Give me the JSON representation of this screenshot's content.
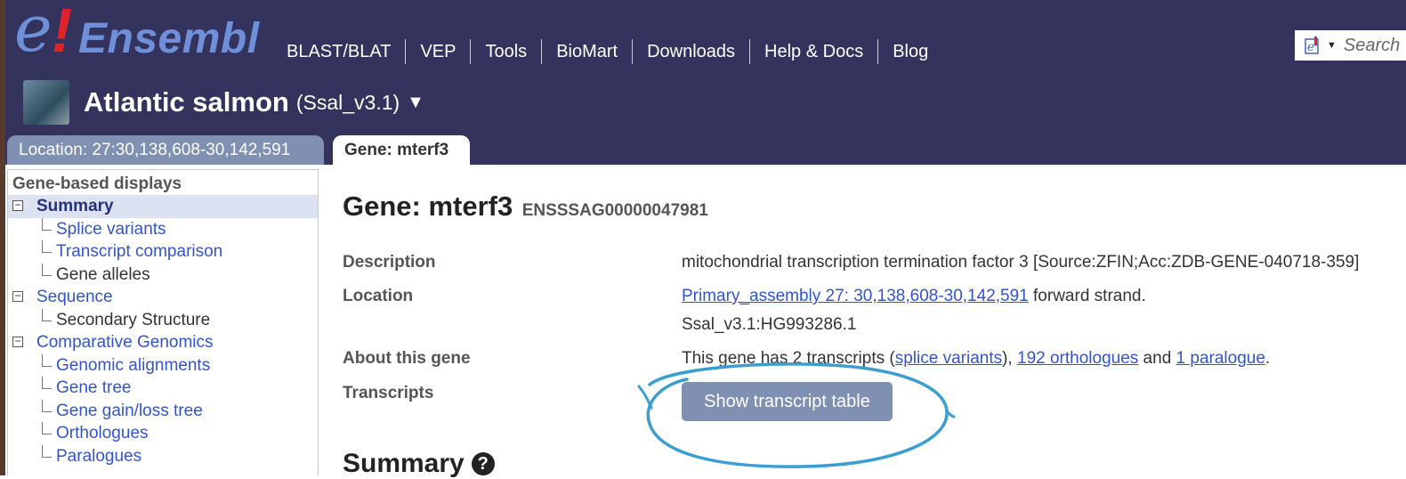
{
  "header": {
    "logo_e": "e",
    "logo_bang": "!",
    "logo_word": "Ensembl",
    "nav": [
      "BLAST/BLAT",
      "VEP",
      "Tools",
      "BioMart",
      "Downloads",
      "Help & Docs",
      "Blog"
    ],
    "search_placeholder": "Search"
  },
  "species": {
    "name": "Atlantic salmon",
    "assembly": "(Ssal_v3.1)",
    "dropdown": "▼"
  },
  "tabs": {
    "location": "Location: 27:30,138,608-30,142,591",
    "gene": "Gene: mterf3"
  },
  "sidebar": {
    "heading": "Gene-based displays",
    "items": [
      {
        "label": "Summary",
        "level": 0,
        "toggle": "−",
        "style": "active"
      },
      {
        "label": "Splice variants",
        "level": 1,
        "style": "link"
      },
      {
        "label": "Transcript comparison",
        "level": 1,
        "style": "link"
      },
      {
        "label": "Gene alleles",
        "level": 1,
        "style": "plain"
      },
      {
        "label": "Sequence",
        "level": 0,
        "toggle": "−",
        "style": "link"
      },
      {
        "label": "Secondary Structure",
        "level": 1,
        "style": "plain"
      },
      {
        "label": "Comparative Genomics",
        "level": 0,
        "toggle": "−",
        "style": "link"
      },
      {
        "label": "Genomic alignments",
        "level": 1,
        "style": "link"
      },
      {
        "label": "Gene tree",
        "level": 1,
        "style": "link"
      },
      {
        "label": "Gene gain/loss tree",
        "level": 1,
        "style": "link"
      },
      {
        "label": "Orthologues",
        "level": 1,
        "style": "link"
      },
      {
        "label": "Paralogues",
        "level": 1,
        "style": "link"
      }
    ]
  },
  "main": {
    "title": "Gene: mterf3",
    "gene_id": "ENSSSAG00000047981",
    "description_label": "Description",
    "description_value": "mitochondrial transcription termination factor 3 [Source:ZFIN;Acc:ZDB-GENE-040718-359]",
    "location_label": "Location",
    "location_link": "Primary_assembly 27: 30,138,608-30,142,591",
    "location_suffix": " forward strand.",
    "location_line2": "Ssal_v3.1:HG993286.1",
    "about_label": "About this gene",
    "about_prefix": "This gene has 2 transcripts (",
    "about_link1": "splice variants",
    "about_mid1": "), ",
    "about_link2": "192 orthologues",
    "about_mid2": " and ",
    "about_link3": "1 paralogue",
    "about_suffix": ".",
    "transcripts_label": "Transcripts",
    "transcripts_button": "Show transcript table",
    "summary_heading": "Summary",
    "summary_help": "?"
  },
  "colors": {
    "header_bg": "#33335e",
    "tab_bg": "#7f90b3",
    "link": "#3355cc",
    "annotation_circle": "#3a9fd0"
  }
}
